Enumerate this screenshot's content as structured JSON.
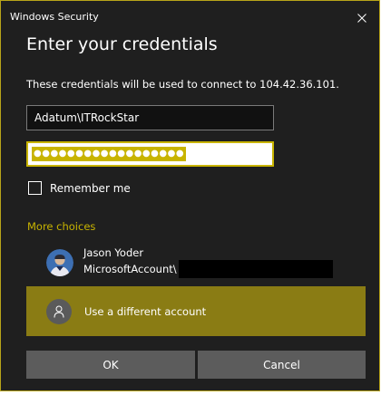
{
  "window": {
    "app_title": "Windows Security"
  },
  "dialog": {
    "heading": "Enter your credentials",
    "description": "These credentials will be used to connect to 104.42.36.101."
  },
  "username": {
    "value": "Adatum\\ITRockStar"
  },
  "password": {
    "masked_value": "●●●●●●●●●●●●●●●●●●"
  },
  "remember": {
    "label": "Remember me",
    "checked": false
  },
  "more_choices": {
    "label": "More choices"
  },
  "account": {
    "name": "Jason Yoder",
    "provider_prefix": "MicrosoftAccount\\"
  },
  "different_account": {
    "label": "Use a different account"
  },
  "buttons": {
    "ok": "OK",
    "cancel": "Cancel"
  },
  "colors": {
    "background": "#1f1f1f",
    "accent": "#c8b400",
    "highlight_tile": "#8a7c14",
    "button": "#5c5c5c"
  },
  "icons": {
    "close": "close-icon",
    "person": "person-icon"
  }
}
